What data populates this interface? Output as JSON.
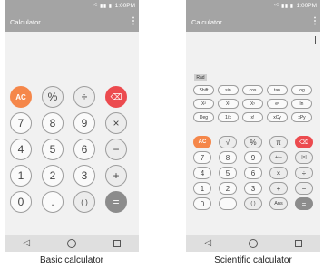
{
  "basic": {
    "status": {
      "icons": "⁴ᴳ ▮▮ ▮",
      "time": "1:00PM"
    },
    "app_title": "Calculator",
    "keys": [
      "AC",
      "%",
      "÷",
      "⌫",
      "7",
      "8",
      "9",
      "×",
      "4",
      "5",
      "6",
      "−",
      "1",
      "2",
      "3",
      "+",
      "0",
      ".",
      "( )",
      "="
    ],
    "caption": "Basic calculator"
  },
  "scientific": {
    "status": {
      "icons": "⁴ᴳ ▮▮ ▮",
      "time": "1:00PM"
    },
    "app_title": "Calculator",
    "mode_label": "Rad",
    "functions": [
      "Shift",
      "sin",
      "cos",
      "tan",
      "log",
      "X²",
      "X³",
      "Xʸ",
      "eˣ",
      "ln",
      "Deg",
      "1/x",
      "x!",
      "xCy",
      "xPy"
    ],
    "keys": [
      "AC",
      "√",
      "%",
      "π",
      "⌫",
      "7",
      "8",
      "9",
      "+/−",
      "|x|",
      "4",
      "5",
      "6",
      "×",
      "÷",
      "1",
      "2",
      "3",
      "+",
      "−",
      "0",
      ".",
      "( )",
      "Ans",
      "="
    ],
    "caption": "Scientific calculator"
  },
  "nav": {
    "back": "◁",
    "home": "○",
    "recent": "□"
  },
  "colors": {
    "bar": "#a4a4a4",
    "clear": "#f5874a",
    "delete": "#ec4b4f",
    "equals": "#8c8c8c"
  }
}
